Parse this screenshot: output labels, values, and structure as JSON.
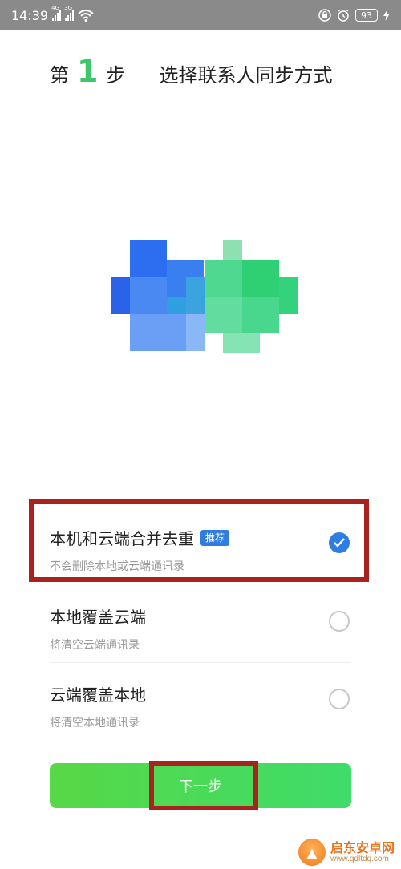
{
  "status_bar": {
    "time": "14:39",
    "sim1_network": "4G",
    "sim2_network": "3G",
    "battery": "93",
    "icons": [
      "signal-icon",
      "signal-icon",
      "wifi-icon",
      "lock-icon",
      "alarm-icon",
      "battery-icon"
    ]
  },
  "header": {
    "step_prefix": "第",
    "step_number": "1",
    "step_suffix": "步",
    "title": "选择联系人同步方式"
  },
  "options": [
    {
      "title": "本机和云端合并去重",
      "badge": "推荐",
      "subtitle": "不会删除本地或云端通讯录",
      "selected": true
    },
    {
      "title": "本地覆盖云端",
      "subtitle": "将清空云端通讯录",
      "selected": false
    },
    {
      "title": "云端覆盖本地",
      "subtitle": "将清空本地通讯录",
      "selected": false
    }
  ],
  "footer": {
    "next_label": "下一步"
  },
  "watermark": {
    "name": "启东安卓网",
    "url": "www.qdltdq.com"
  },
  "colors": {
    "accent_green": "#3cc768",
    "accent_blue": "#2f7de1",
    "highlight_red": "#a8221e",
    "status_bar_bg": "#8a8a8a"
  }
}
